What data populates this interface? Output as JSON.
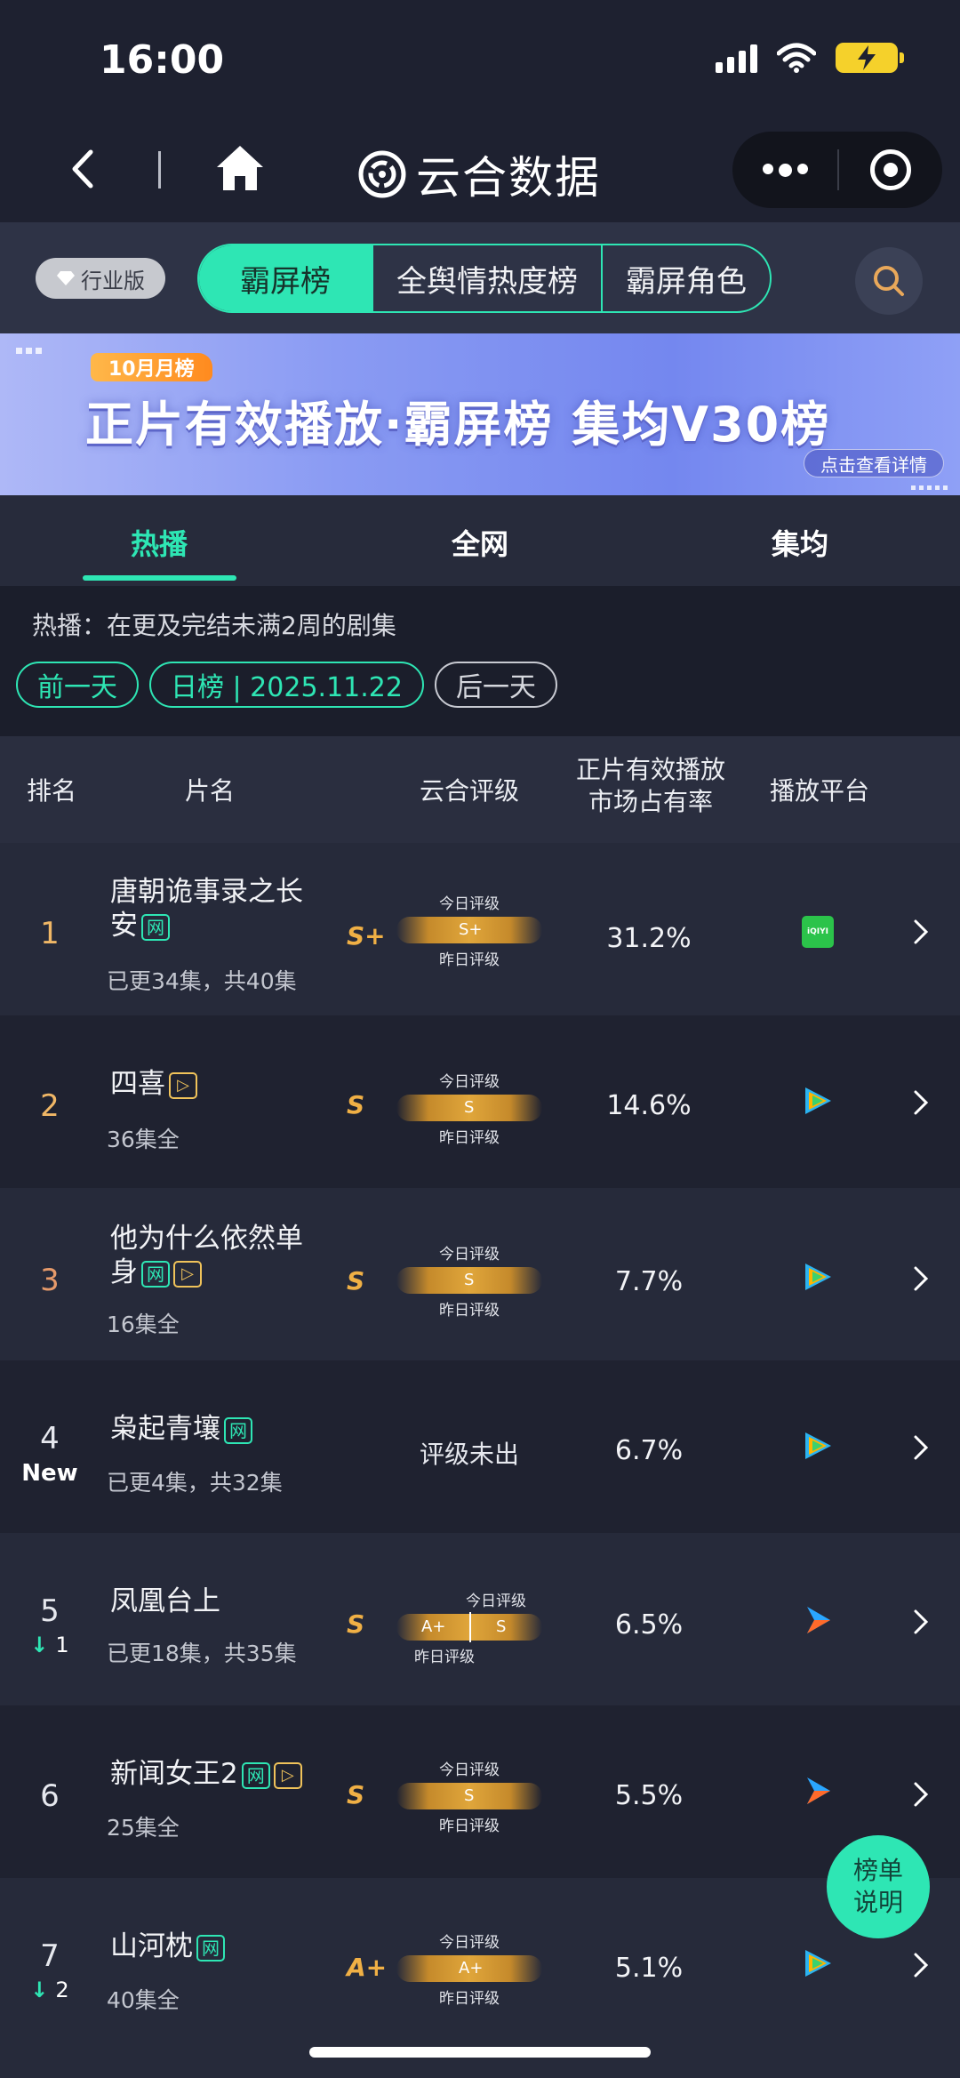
{
  "status_bar": {
    "time": "16:00"
  },
  "nav": {
    "title": "云合数据"
  },
  "filters": {
    "edition": "行业版",
    "segments": [
      "霸屏榜",
      "全舆情热度榜",
      "霸屏角色"
    ]
  },
  "banner": {
    "tag": "10月月榜",
    "title": "正片有效播放·霸屏榜 集均V30榜",
    "link": "点击查看详情"
  },
  "tabs": [
    "热播",
    "全网",
    "集均"
  ],
  "description": "热播：在更及完结未满2周的剧集",
  "date_nav": {
    "prev": "前一天",
    "current": "日榜 | 2025.11.22",
    "next": "后一天"
  },
  "table_header": {
    "rank": "排名",
    "name": "片名",
    "rating": "云合评级",
    "share_line1": "正片有效播放",
    "share_line2": "市场占有率",
    "platform": "播放平台"
  },
  "rating_labels": {
    "today": "今日评级",
    "yesterday": "昨日评级",
    "none": "评级未出"
  },
  "badges": {
    "web": "网",
    "vip": "▷"
  },
  "rows": [
    {
      "rank": "1",
      "title_a": "唐朝诡事录之长",
      "title_b": "安",
      "web": true,
      "vip": false,
      "episodes": "已更34集，共40集",
      "grade": "S+",
      "bar_text": "S+",
      "share": "31.2%",
      "platform": "iqiyi-icon",
      "platform_text": "iQIYI"
    },
    {
      "rank": "2",
      "title_a": "四喜",
      "title_b": "",
      "web": false,
      "vip": true,
      "episodes": "36集全",
      "grade": "S",
      "bar_text": "S",
      "share": "14.6%",
      "platform": "tencent-video-icon"
    },
    {
      "rank": "3",
      "title_a": "他为什么依然单",
      "title_b": "身",
      "web": true,
      "vip": true,
      "episodes": "16集全",
      "grade": "S",
      "bar_text": "S",
      "share": "7.7%",
      "platform": "tencent-video-icon"
    },
    {
      "rank": "4",
      "rank_note": "New",
      "title_a": "枭起青壤",
      "title_b": "",
      "web": true,
      "vip": false,
      "episodes": "已更4集，共32集",
      "grade": "",
      "bar_text": "",
      "share": "6.7%",
      "platform": "tencent-video-icon"
    },
    {
      "rank": "5",
      "rank_change": "1",
      "title_a": "凤凰台上",
      "title_b": "",
      "web": false,
      "vip": false,
      "episodes": "已更18集，共35集",
      "grade": "S",
      "bar_text_yesterday": "A+",
      "bar_text": "S",
      "share": "6.5%",
      "platform": "youku-icon"
    },
    {
      "rank": "6",
      "title_a": "新闻女王2",
      "title_b": "",
      "web": true,
      "vip": true,
      "episodes": "25集全",
      "grade": "S",
      "bar_text": "S",
      "share": "5.5%",
      "platform": "youku-icon"
    },
    {
      "rank": "7",
      "rank_change": "2",
      "title_a": "山河枕",
      "title_b": "",
      "web": true,
      "vip": false,
      "episodes": "40集全",
      "grade": "A+",
      "bar_text": "A+",
      "share": "5.1%",
      "platform": "tencent-video-icon"
    }
  ],
  "help_button": {
    "line1": "榜单",
    "line2": "说明"
  },
  "colors": {
    "accent": "#2ee6b4",
    "gold": "#f0b045",
    "background": "#1b1e2b"
  }
}
